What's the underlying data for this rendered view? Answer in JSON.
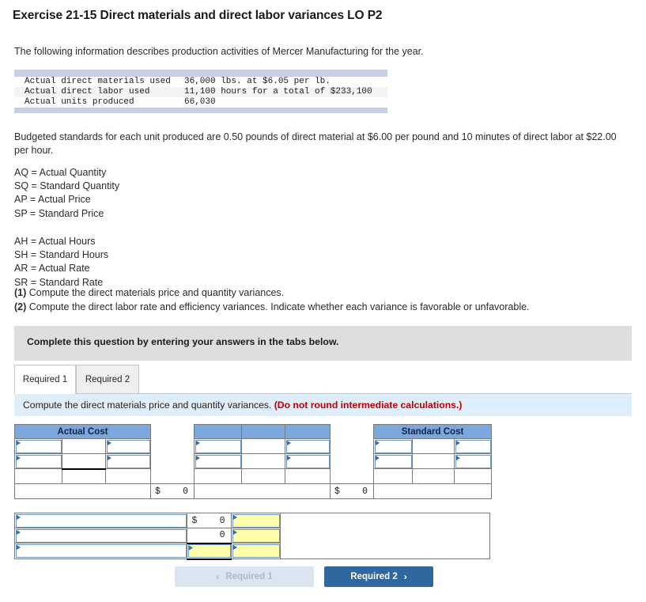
{
  "title": "Exercise 21-15 Direct materials and direct labor variances LO P2",
  "intro": "The following information describes production activities of Mercer Manufacturing for the year.",
  "facts": {
    "rows": [
      {
        "label": "Actual direct materials used",
        "value": "36,000 lbs. at $6.05 per lb."
      },
      {
        "label": "Actual direct labor used",
        "value": "11,100 hours for a total of $233,100"
      },
      {
        "label": "Actual units produced",
        "value": "66,030"
      }
    ]
  },
  "budget_note": "Budgeted standards for each unit produced are 0.50 pounds of direct material at $6.00 per pound and 10 minutes of direct labor at $22.00 per hour.",
  "definitions_group_1": [
    "AQ = Actual Quantity",
    "SQ = Standard Quantity",
    "AP = Actual Price",
    "SP = Standard Price"
  ],
  "definitions_group_2": [
    "AH = Actual Hours",
    "SH = Standard Hours",
    "AR = Actual Rate",
    "SR = Standard Rate"
  ],
  "requirements": [
    {
      "num": "(1)",
      "text": "Compute the direct materials price and quantity variances."
    },
    {
      "num": "(2)",
      "text": "Compute the direct labor rate and efficiency variances. Indicate whether each variance is favorable or unfavorable."
    }
  ],
  "grey_bar": "Complete this question by entering your answers in the tabs below.",
  "tabs": [
    {
      "label": "Required 1",
      "active": true
    },
    {
      "label": "Required 2",
      "active": false
    }
  ],
  "sub_instruction": {
    "text": "Compute the direct materials price and quantity variances. ",
    "emphasis": "(Do not round intermediate calculations.)"
  },
  "answer_grid": {
    "headers": {
      "actual_cost": "Actual Cost",
      "standard_cost": "Standard Cost"
    },
    "totals": [
      {
        "currency": "$",
        "amount": "0"
      },
      {
        "currency": "$",
        "amount": "0"
      }
    ],
    "input_values": [
      "",
      "",
      "",
      "",
      "",
      "",
      "",
      "",
      "",
      "",
      "",
      ""
    ]
  },
  "variance_table": {
    "rows": [
      {
        "label": "",
        "currency": "$",
        "amount": "0",
        "fav": ""
      },
      {
        "label": "",
        "currency": "",
        "amount": "0",
        "fav": ""
      },
      {
        "label": "",
        "currency": "",
        "amount": "",
        "fav": ""
      }
    ]
  },
  "nav": {
    "prev": {
      "label": "Required 1",
      "icon": "chevron-left"
    },
    "next": {
      "label": "Required 2",
      "icon": "chevron-right"
    }
  },
  "colors": {
    "header_blue": "#7ba7dd",
    "input_border": "#6a96c8",
    "yellow_cell": "#ffffaa",
    "accent_button": "#30679f",
    "red_emphasis": "#c00000",
    "grey_bar": "#dedede",
    "blue_bar": "#dfeefb"
  }
}
